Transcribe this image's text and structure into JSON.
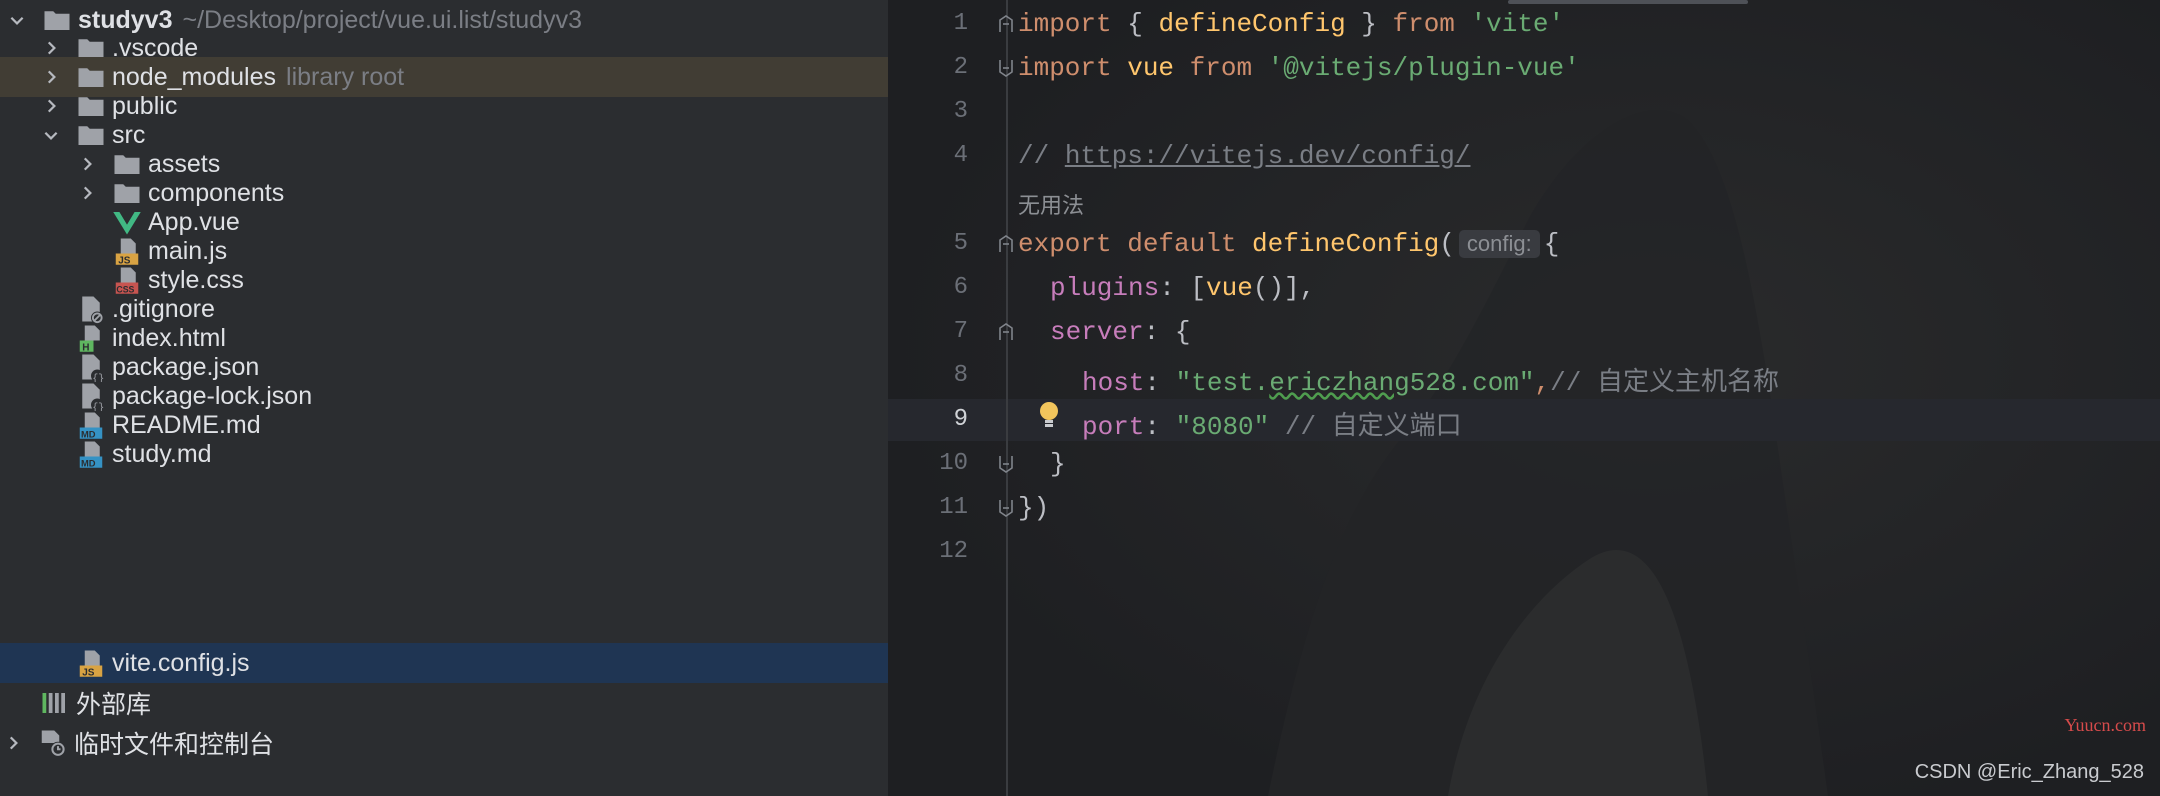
{
  "project": {
    "root_name": "studyv3",
    "root_path": "~/Desktop/project/vue.ui.list/studyv3",
    "items": [
      {
        "label": ".vscode",
        "hint": ""
      },
      {
        "label": "node_modules",
        "hint": "library root"
      },
      {
        "label": "public",
        "hint": ""
      },
      {
        "label": "src",
        "hint": ""
      },
      {
        "label": "assets",
        "hint": ""
      },
      {
        "label": "components",
        "hint": ""
      },
      {
        "label": "App.vue",
        "hint": ""
      },
      {
        "label": "main.js",
        "hint": ""
      },
      {
        "label": "style.css",
        "hint": ""
      },
      {
        "label": ".gitignore",
        "hint": ""
      },
      {
        "label": "index.html",
        "hint": ""
      },
      {
        "label": "package.json",
        "hint": ""
      },
      {
        "label": "package-lock.json",
        "hint": ""
      },
      {
        "label": "README.md",
        "hint": ""
      },
      {
        "label": "study.md",
        "hint": ""
      },
      {
        "label": "vite.config.js",
        "hint": ""
      }
    ],
    "external_libraries": "外部库",
    "scratches": "临时文件和控制台"
  },
  "editor": {
    "line_numbers": [
      "1",
      "2",
      "3",
      "4",
      "5",
      "6",
      "7",
      "8",
      "9",
      "10",
      "11",
      "12"
    ],
    "active_line": "9",
    "usage_hint": "无用法",
    "inlay_param": "config:",
    "code": {
      "l1_import": "import",
      "l1_brace_open": " { ",
      "l1_name": "defineConfig",
      "l1_brace_close": " } ",
      "l1_from": "from",
      "l1_module": " 'vite'",
      "l2_import": "import",
      "l2_name": " vue ",
      "l2_from": "from",
      "l2_module": " '@vitejs/plugin-vue'",
      "l4_comment": "// ",
      "l4_link": "https://vitejs.dev/config/",
      "l5_export": "export default ",
      "l5_fn": "defineConfig",
      "l5_paren": "(",
      "l5_brace": "{",
      "l6_prop": "plugins",
      "l6_colon": ": [",
      "l6_fn": "vue",
      "l6_rest": "()],",
      "l7_prop": "server",
      "l7_rest": ": {",
      "l8_prop": "host",
      "l8_colon": ": ",
      "l8_str_a": "\"test.",
      "l8_str_typo": "ericzhang",
      "l8_str_b": "528.com\"",
      "l8_comma": ",",
      "l8_comment": "// 自定义主机名称",
      "l9_prop": "port",
      "l9_colon": ": ",
      "l9_str": "\"8080\"",
      "l9_comment": " // 自定义端口",
      "l10": "}",
      "l11": "})"
    }
  },
  "footer": {
    "brand": "Yuucn.com",
    "watermark": "CSDN @Eric_Zhang_528"
  },
  "colors": {
    "sidebar_bg": "#2b2d30",
    "editor_bg": "#1e1f22",
    "selection": "#1f3553",
    "library_highlight": "#413d34"
  }
}
